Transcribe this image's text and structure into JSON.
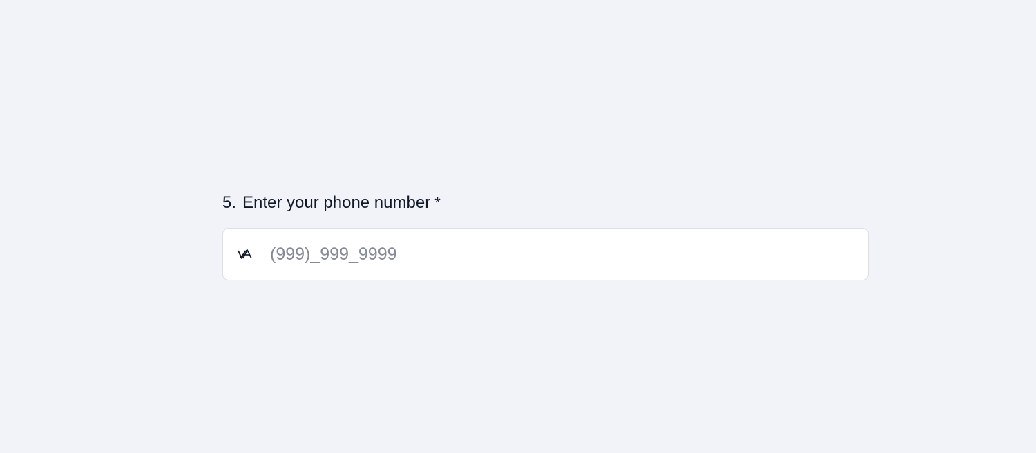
{
  "question": {
    "number": "5.",
    "label": "Enter your phone number",
    "required_marker": "*"
  },
  "phone_field": {
    "value": "",
    "placeholder": "(999)_999_9999",
    "country_icon": "country-flag-icon"
  },
  "colors": {
    "background": "#f1f3f8",
    "field_background": "#ffffff",
    "field_border": "#dcdfe6",
    "text": "#111827",
    "placeholder": "#858a96"
  }
}
